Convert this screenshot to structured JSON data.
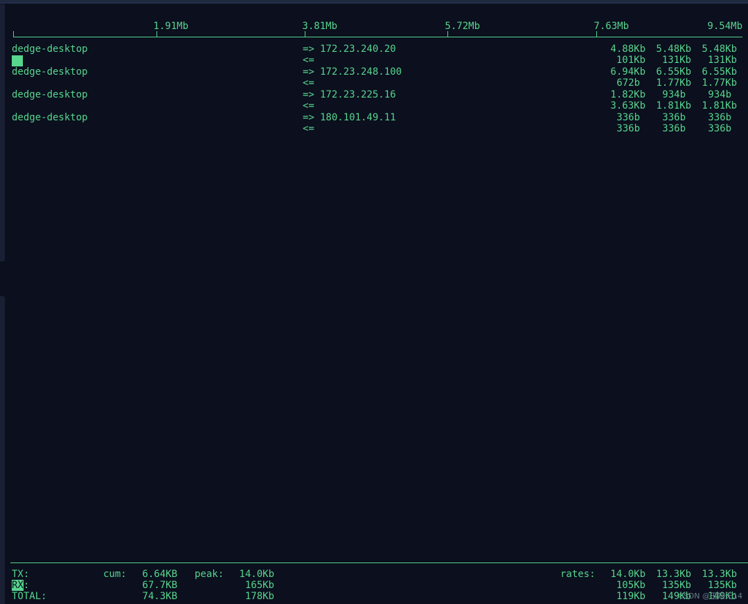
{
  "scale": {
    "ticks": [
      "1.91Mb",
      "3.81Mb",
      "5.72Mb",
      "7.63Mb",
      "9.54Mb"
    ]
  },
  "connections": [
    {
      "host": "dedge-desktop",
      "out_arrow": "=>",
      "in_arrow": "<=",
      "remote": "172.23.240.20",
      "out_rates": [
        "4.88Kb",
        "5.48Kb",
        "5.48Kb"
      ],
      "in_rates": [
        "101Kb",
        "131Kb",
        "131Kb"
      ]
    },
    {
      "host": "dedge-desktop",
      "out_arrow": "=>",
      "in_arrow": "<=",
      "remote": "172.23.248.100",
      "out_rates": [
        "6.94Kb",
        "6.55Kb",
        "6.55Kb"
      ],
      "in_rates": [
        "672b",
        "1.77Kb",
        "1.77Kb"
      ]
    },
    {
      "host": "dedge-desktop",
      "out_arrow": "=>",
      "in_arrow": "<=",
      "remote": "172.23.225.16",
      "out_rates": [
        "1.82Kb",
        "934b",
        "934b"
      ],
      "in_rates": [
        "3.63Kb",
        "1.81Kb",
        "1.81Kb"
      ]
    },
    {
      "host": "dedge-desktop",
      "out_arrow": "=>",
      "in_arrow": "<=",
      "remote": "180.101.49.11",
      "out_rates": [
        "336b",
        "336b",
        "336b"
      ],
      "in_rates": [
        "336b",
        "336b",
        "336b"
      ]
    }
  ],
  "summary": {
    "cum_label": "cum:",
    "peak_label": "peak:",
    "rates_label": "rates:",
    "rows": [
      {
        "label": "TX:",
        "cum": "6.64KB",
        "peak": "14.0Kb",
        "rates": [
          "14.0Kb",
          "13.3Kb",
          "13.3Kb"
        ]
      },
      {
        "label_hl": "RX",
        "label_rest": ":",
        "cum": "67.7KB",
        "peak": "165Kb",
        "rates": [
          "105Kb",
          "135Kb",
          "135Kb"
        ]
      },
      {
        "label": "TOTAL:",
        "cum": "74.3KB",
        "peak": "178Kb",
        "rates": [
          "119Kb",
          "149Kb",
          "149Kb"
        ]
      }
    ]
  },
  "watermark": "CSDN @王知无14"
}
